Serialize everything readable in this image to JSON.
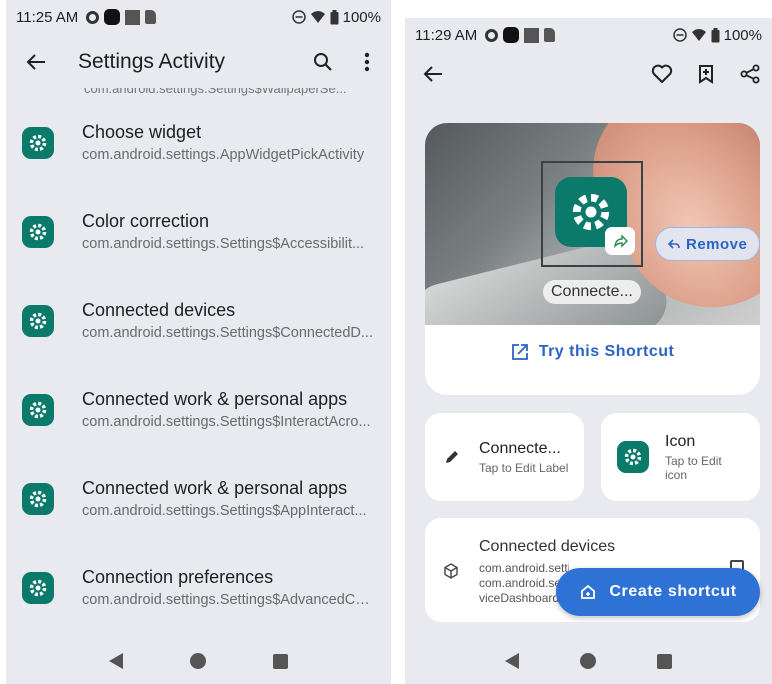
{
  "left_screen": {
    "status": {
      "time": "11:25 AM",
      "battery": "100%"
    },
    "appbar": {
      "title": "Settings Activity"
    },
    "partial_item": "com.android.settings.Settings$WallpaperSe...",
    "items": [
      {
        "title": "Choose widget",
        "subtitle": "com.android.settings.AppWidgetPickActivity"
      },
      {
        "title": "Color correction",
        "subtitle": "com.android.settings.Settings$Accessibilit..."
      },
      {
        "title": "Connected devices",
        "subtitle": "com.android.settings.Settings$ConnectedD..."
      },
      {
        "title": "Connected work & personal apps",
        "subtitle": "com.android.settings.Settings$InteractAcro..."
      },
      {
        "title": "Connected work & personal apps",
        "subtitle": "com.android.settings.Settings$AppInteract..."
      },
      {
        "title": "Connection preferences",
        "subtitle": "com.android.settings.Settings$AdvancedCo..."
      }
    ]
  },
  "right_screen": {
    "status": {
      "time": "11:29 AM",
      "battery": "100%"
    },
    "preview": {
      "shortcut_label": "Connecte...",
      "remove_label": "Remove",
      "try_label": "Try this Shortcut"
    },
    "label_card": {
      "title": "Connecte...",
      "subtitle": "Tap to Edit Label"
    },
    "icon_card": {
      "title": "Icon",
      "subtitle": "Tap to Edit icon"
    },
    "info_card": {
      "title": "Connected devices",
      "line1": "com.android.settings...",
      "line2": "com.android.se...",
      "line3": "viceDashboardA..."
    },
    "fab": {
      "label": "Create shortcut"
    }
  },
  "colors": {
    "accent": "#2f72d6",
    "app_icon": "#0b7a6b",
    "background": "#e8eaef"
  }
}
